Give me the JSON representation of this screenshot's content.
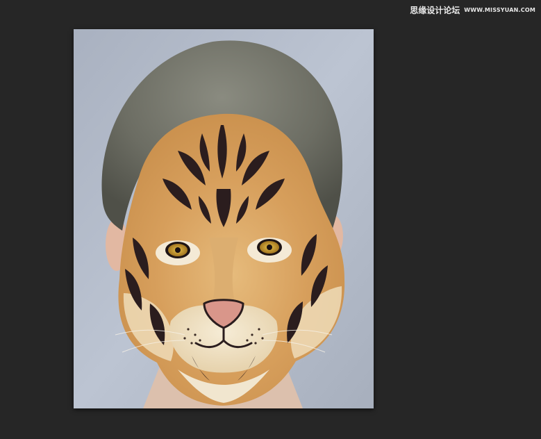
{
  "watermark": {
    "site_name_cn": "思缘设计论坛",
    "site_url": "WWW.MISSYUAN.COM"
  },
  "document": {
    "image_subject": "tiger-face-composite-portrait"
  },
  "colors": {
    "workspace_bg": "#262626",
    "photo_bg": "#b4bccb",
    "hair": "#6f7067",
    "skin": "#e2c0a8",
    "fur_orange": "#d9a463",
    "fur_light": "#f1e2c2",
    "stripe": "#2b1d1e",
    "eye": "#c99a2a",
    "nose": "#d99a8e"
  }
}
